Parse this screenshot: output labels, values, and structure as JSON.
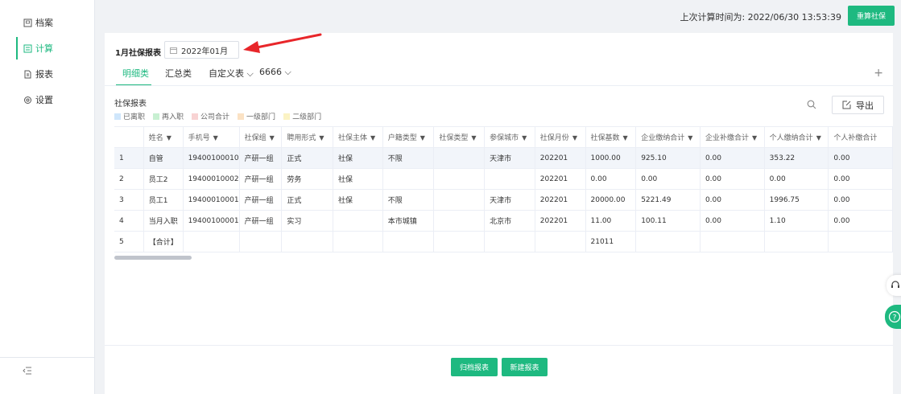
{
  "sidebar": {
    "items": [
      {
        "label": "档案",
        "icon": "archive-icon"
      },
      {
        "label": "计算",
        "icon": "calculator-icon",
        "active": true
      },
      {
        "label": "报表",
        "icon": "report-icon"
      },
      {
        "label": "设置",
        "icon": "gear-icon"
      }
    ]
  },
  "topbar": {
    "last_calc_text": "上次计算时间为: 2022/06/30 13:53:39",
    "recalc_label": "重算社保"
  },
  "report": {
    "title": "1月社保报表",
    "date_value": "2022年01月"
  },
  "tabs": {
    "detail": "明细类",
    "summary": "汇总类",
    "custom": "自定义表",
    "custom2": "6666"
  },
  "table_section": {
    "title": "社保报表",
    "export_label": "导出",
    "legend": [
      {
        "label": "已离职",
        "color": "#cfe6fb"
      },
      {
        "label": "再入职",
        "color": "#c8f0d2"
      },
      {
        "label": "公司合计",
        "color": "#f8d3d3"
      },
      {
        "label": "一级部门",
        "color": "#fbe2c4"
      },
      {
        "label": "二级部门",
        "color": "#fbf3c4"
      }
    ]
  },
  "table": {
    "columns": [
      "",
      "姓名",
      "手机号",
      "社保组",
      "聘用形式",
      "社保主体",
      "户籍类型",
      "社保类型",
      "参保城市",
      "社保月份",
      "社保基数",
      "企业缴纳合计",
      "企业补缴合计",
      "个人缴纳合计",
      "个人补缴合计"
    ],
    "rows": [
      [
        "1",
        "自管",
        "19400100010",
        "产研一组",
        "正式",
        "社保",
        "不限",
        "",
        "天津市",
        "202201",
        "1000.00",
        "925.10",
        "0.00",
        "353.22",
        "0.00"
      ],
      [
        "2",
        "员工2",
        "19400010002",
        "产研一组",
        "劳务",
        "社保",
        "",
        "",
        "",
        "202201",
        "0.00",
        "0.00",
        "0.00",
        "0.00",
        "0.00"
      ],
      [
        "3",
        "员工1",
        "19400010001",
        "产研一组",
        "正式",
        "社保",
        "不限",
        "",
        "天津市",
        "202201",
        "20000.00",
        "5221.49",
        "0.00",
        "1996.75",
        "0.00"
      ],
      [
        "4",
        "当月入职",
        "19400100001",
        "产研一组",
        "实习",
        "",
        "本市城镇",
        "",
        "北京市",
        "202201",
        "11.00",
        "100.11",
        "0.00",
        "1.10",
        "0.00"
      ],
      [
        "5",
        "【合计】",
        "",
        "",
        "",
        "",
        "",
        "",
        "",
        "",
        "21011",
        "",
        "",
        "",
        ""
      ]
    ]
  },
  "footer": {
    "archive_label": "归档报表",
    "new_label": "新建报表"
  },
  "colors": {
    "accent": "#1eb980",
    "arrow": "#e8262a"
  }
}
